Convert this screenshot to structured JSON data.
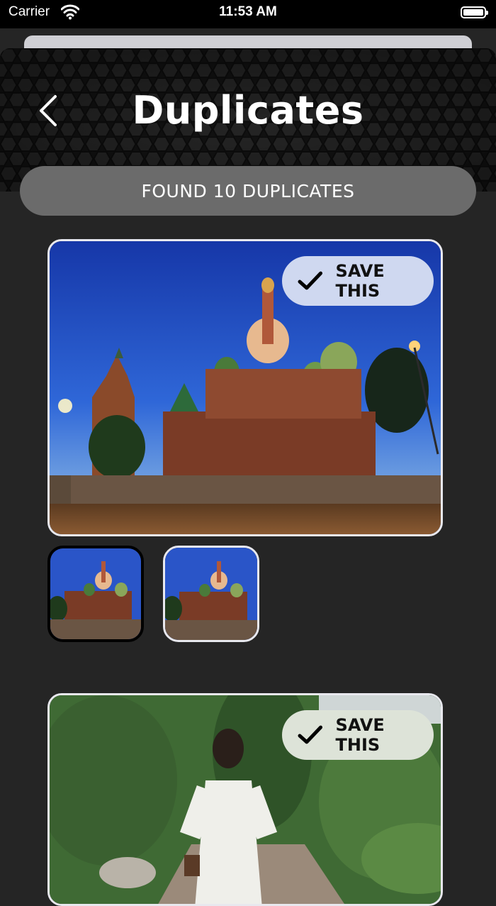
{
  "status_bar": {
    "carrier": "Carrier",
    "time": "11:53 AM"
  },
  "header": {
    "title": "Duplicates",
    "back_icon": "chevron-left-icon"
  },
  "banner": {
    "text": "FOUND 10 DUPLICATES"
  },
  "groups": [
    {
      "save_label": "SAVE THIS",
      "thumbnail_count": 2,
      "selected_thumbnail": 1
    },
    {
      "save_label": "SAVE THIS"
    }
  ],
  "colors": {
    "background": "#252525",
    "banner": "#6b6b6b",
    "save_button_1": "#cfd8f0",
    "save_button_2": "#dde3d8",
    "card_border": "#e8e8ee"
  }
}
